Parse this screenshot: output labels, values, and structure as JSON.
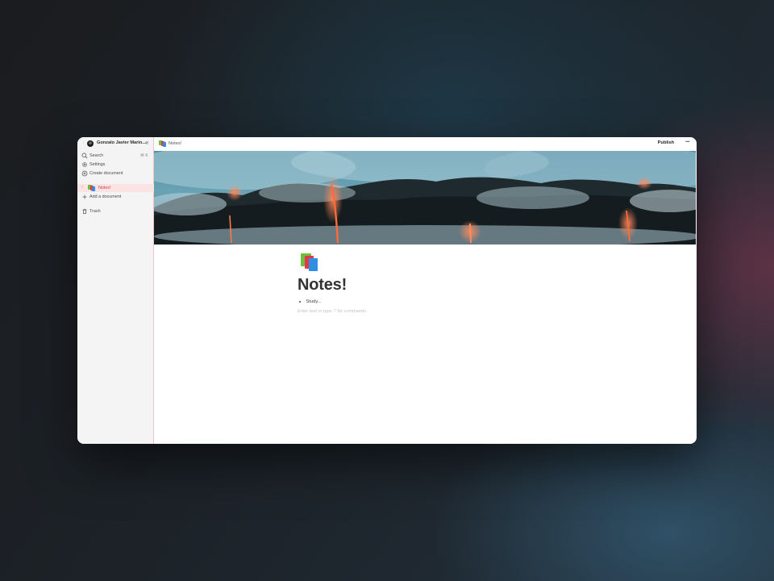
{
  "sidebar": {
    "workspace_name": "Gonzalo Javier Marin...",
    "nav": {
      "search_label": "Search",
      "search_shortcut": "⌘ K",
      "settings_label": "Settings",
      "create_label": "Create document"
    },
    "documents": [
      {
        "label": "Notes!",
        "icon": "books-emoji",
        "active": true
      }
    ],
    "add_document_label": "Add a document",
    "trash_label": "Trash"
  },
  "topbar": {
    "breadcrumb_label": "Notes!",
    "publish_label": "Publish",
    "more_label": "···"
  },
  "document": {
    "title": "Notes!",
    "bullets": [
      "Study..."
    ],
    "placeholder": "Enter text or type '/' for commands",
    "icon": "books-emoji"
  },
  "colors": {
    "active_item_bg": "#fbe3e3",
    "active_item_text": "#d04444",
    "sidebar_bg": "#f4f4f4"
  }
}
